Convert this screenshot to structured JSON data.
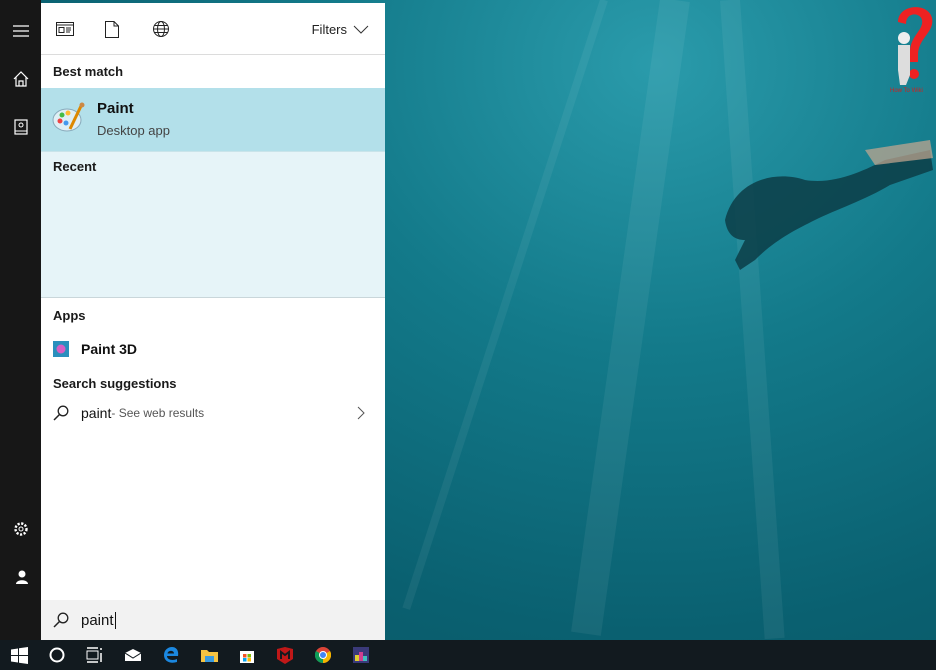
{
  "toolbar": {
    "filters_label": "Filters",
    "icons": [
      "apps-icon",
      "documents-icon",
      "web-icon"
    ]
  },
  "best_match": {
    "heading": "Best match",
    "title": "Paint",
    "subtitle": "Desktop app"
  },
  "recent": {
    "heading": "Recent"
  },
  "apps": {
    "heading": "Apps",
    "items": [
      {
        "label": "Paint 3D"
      }
    ]
  },
  "suggestions": {
    "heading": "Search suggestions",
    "items": [
      {
        "term": "paint",
        "suffix": " - See web results"
      }
    ]
  },
  "search": {
    "value": "paint"
  },
  "logo": {
    "text": "How To Wiki"
  },
  "taskbar": {
    "items": [
      "start",
      "cortana",
      "task-view",
      "mail",
      "edge",
      "file-explorer",
      "store",
      "mcafee",
      "chrome",
      "app"
    ]
  },
  "colors": {
    "selection": "#b3e0ea",
    "panel": "#e6f4f8",
    "rail": "#171717",
    "taskbar": "#121a1f"
  }
}
